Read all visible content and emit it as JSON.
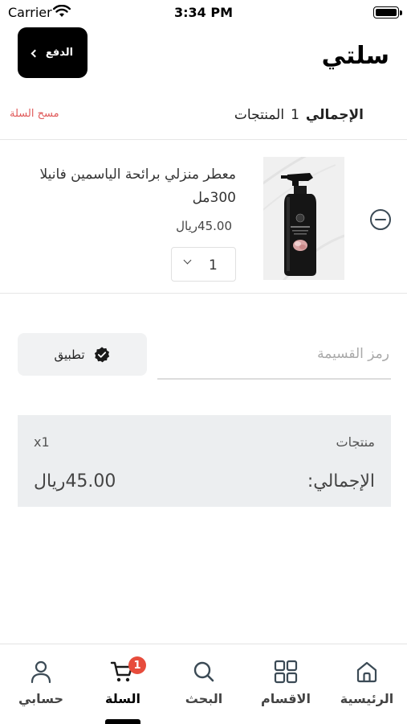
{
  "status_bar": {
    "carrier": "Carrier",
    "time": "3:34 PM"
  },
  "header": {
    "title": "سلتي",
    "pay_label": "الدفع"
  },
  "cart_summary": {
    "total_label": "الإجمالي",
    "count": "1",
    "count_label": "المنتجات",
    "clear_label": "مسح السلة"
  },
  "item": {
    "name": "معطر منزلي برائحة الياسمين فانيلا 300مل",
    "price": "45.00ريال",
    "quantity": "1"
  },
  "coupon": {
    "placeholder": "رمز القسيمة",
    "apply_label": "تطبيق"
  },
  "totals": {
    "products_label": "منتجات",
    "products_count": "x1",
    "total_label": "الإجمالي:",
    "total_value": "45.00ريال"
  },
  "tabs": [
    {
      "label": "الرئيسية",
      "icon": "home-icon"
    },
    {
      "label": "الاقسام",
      "icon": "grid-icon"
    },
    {
      "label": "البحث",
      "icon": "search-icon"
    },
    {
      "label": "السلة",
      "icon": "cart-icon",
      "badge": "1",
      "active": true
    },
    {
      "label": "حسابي",
      "icon": "user-icon"
    }
  ],
  "colors": {
    "accent": "#000000",
    "danger": "#e05a5a",
    "badge": "#e74c3c",
    "panel": "#eceef0"
  }
}
